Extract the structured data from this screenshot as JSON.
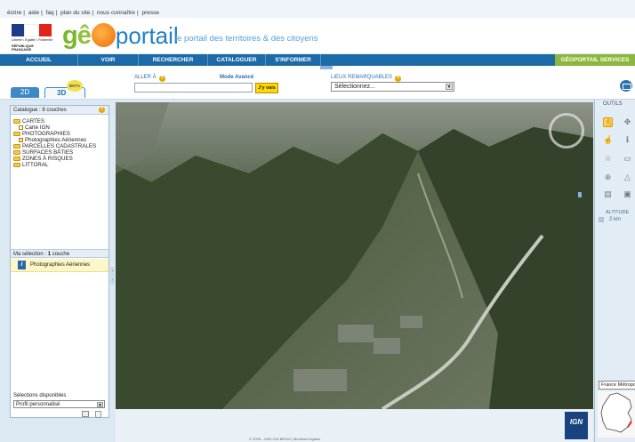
{
  "top_links": [
    "écrire",
    "aide",
    "faq",
    "plan du site",
    "nous connaître",
    "presse"
  ],
  "top_links_sep": "|",
  "header": {
    "republic_text": [
      "Liberté • Égalité • Fraternité",
      "RÉPUBLIQUE FRANÇAISE"
    ],
    "logo_g": "g",
    "logo_e": "ê",
    "logo_rest": "portail",
    "tagline": "le portail des territoires & des citoyens"
  },
  "menu": [
    "ACCUEIL",
    "VOIR",
    "RECHERCHER",
    "CATALOGUER",
    "S'INFORMER",
    "GÉOPORTAIL SERVICES"
  ],
  "view_toggle": {
    "btn_2d": "2D",
    "btn_3d": "3D",
    "beta": "BETA"
  },
  "goto": {
    "label": "ALLER À",
    "mode": "Mode Avancé",
    "button": "J'y vais",
    "value": ""
  },
  "lieux": {
    "label": "LIEUX REMARQUABLES",
    "selected": "Sélectionnez..."
  },
  "catalog": {
    "title": "Catalogue : 8 couches",
    "items": [
      {
        "type": "folder",
        "label": "CARTES"
      },
      {
        "type": "check",
        "label": "Carte IGN",
        "checked": false
      },
      {
        "type": "folder",
        "label": "PHOTOGRAPHIES"
      },
      {
        "type": "check",
        "label": "Photographies Aériennes",
        "checked": true
      },
      {
        "type": "folder",
        "label": "PARCELLES CADASTRALES"
      },
      {
        "type": "folder",
        "label": "SURFACES BÂTIES"
      },
      {
        "type": "folder",
        "label": "ZONES À RISQUES"
      },
      {
        "type": "folder",
        "label": "LITTORAL"
      }
    ]
  },
  "my_selection": {
    "prefix": "Ma sélection : ",
    "count": "1",
    "suffix": " couche",
    "item": "Photographies Aériennes"
  },
  "saved_selections": {
    "label": "Sélections disponibles",
    "selected": "Profil personnalisé"
  },
  "right_panel": {
    "title": "OUTILS",
    "altitude_label": "ALTITUDE",
    "altitude_value": "2 km",
    "region_select": "France Métropolitaine"
  },
  "map": {
    "provider": "IGN",
    "copyright": "© 2008 - 2009 IGN BRGM | Mentions légales"
  },
  "colors": {
    "menu_bar": "#1c6aa8",
    "services": "#8cb63c",
    "accent_orange": "#ef6b0a",
    "logo_green": "#77b82a"
  }
}
